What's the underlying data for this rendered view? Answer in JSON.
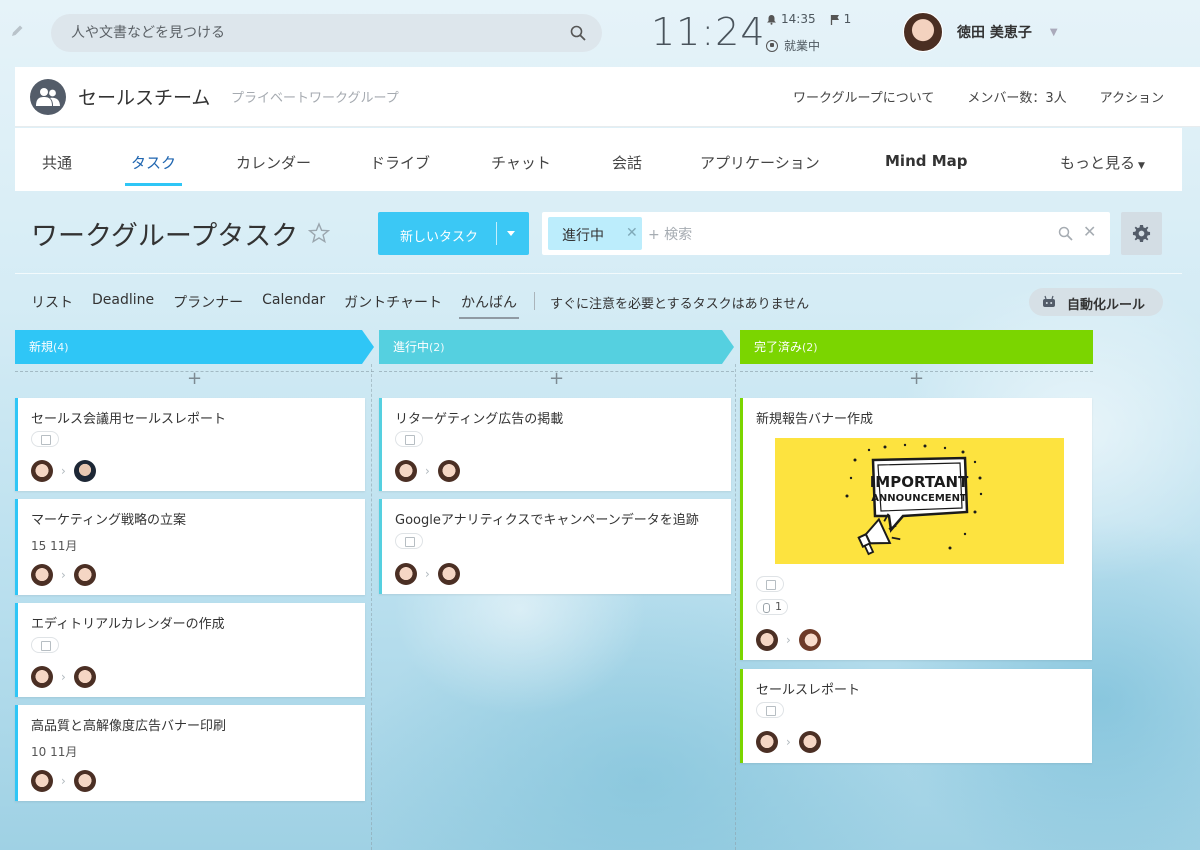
{
  "topbar": {
    "search_placeholder": "人や文書などを見つける",
    "time": "11:24",
    "alarm_time": "14:35",
    "flag_count": "1",
    "work_status": "就業中",
    "user_name": "徳田 美恵子"
  },
  "group": {
    "title": "セールスチーム",
    "subtitle": "プライベートワークグループ",
    "actions": [
      "ワークグループについて",
      "メンバー数：3人",
      "アクション"
    ]
  },
  "tabs": [
    "共通",
    "タスク",
    "カレンダー",
    "ドライブ",
    "チャット",
    "会話",
    "アプリケーション",
    "Mind Map",
    "もっと見る"
  ],
  "active_tab": "タスク",
  "page": {
    "title": "ワークグループタスク",
    "new_task_label": "新しいタスク",
    "filter_chip": "進行中",
    "filter_placeholder": "+ 検索"
  },
  "views": [
    "リスト",
    "Deadline",
    "プランナー",
    "Calendar",
    "ガントチャート",
    "かんばん"
  ],
  "active_view": "かんばん",
  "notice": "すぐに注意を必要とするタスクはありません",
  "automation_label": "自動化ルール",
  "colors": {
    "new": "#2fc6f6",
    "in_progress": "#55d0e0",
    "done": "#7bd500",
    "accent": "#3bc8f5"
  },
  "columns": [
    {
      "name": "新規",
      "count": "(4)",
      "cards": [
        {
          "title": "セールス会議用セールスレポート",
          "due": ""
        },
        {
          "title": "マーケティング戦略の立案",
          "due": "15 11月"
        },
        {
          "title": "エディトリアルカレンダーの作成",
          "due": ""
        },
        {
          "title": "高品質と高解像度広告バナー印刷",
          "due": "10 11月"
        }
      ]
    },
    {
      "name": "進行中",
      "count": "(2)",
      "cards": [
        {
          "title": "リターゲティング広告の掲載",
          "due": ""
        },
        {
          "title": "Googleアナリティクスでキャンペーンデータを追跡",
          "due": ""
        }
      ]
    },
    {
      "name": "完了済み",
      "count": "(2)",
      "cards": [
        {
          "title": "新規報告バナー作成",
          "due": "",
          "attachments": "1",
          "banner": [
            "IMPORTANT",
            "ANNOUNCEMENT"
          ]
        },
        {
          "title": "セールスレポート",
          "due": ""
        }
      ]
    }
  ],
  "add_symbol": "+"
}
